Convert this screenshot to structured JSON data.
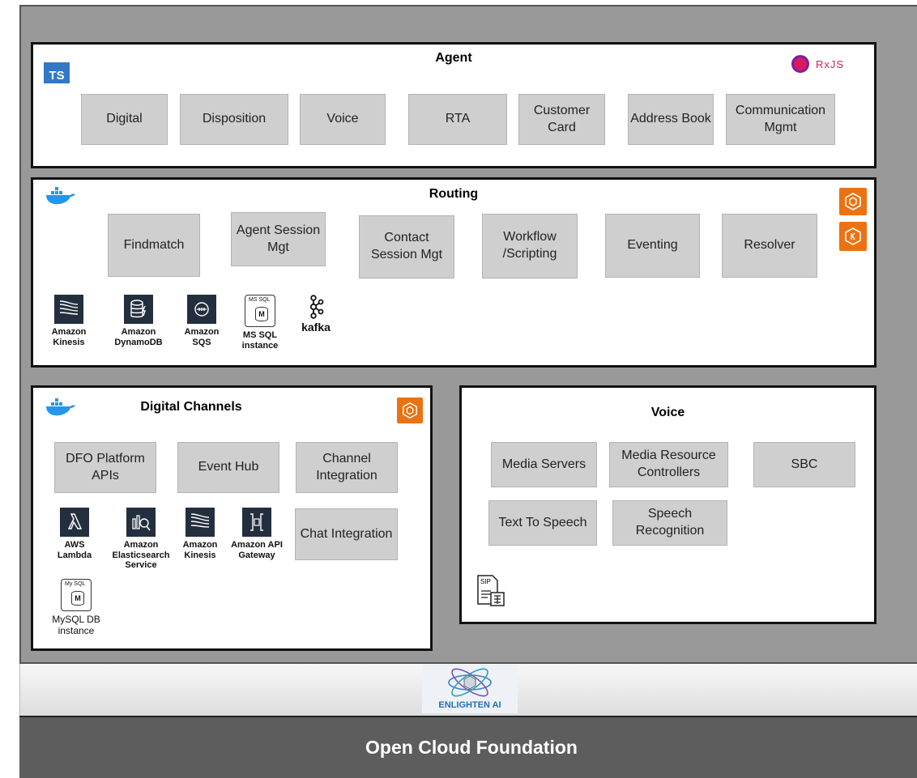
{
  "agent": {
    "title": "Agent",
    "ts_badge": "TS",
    "rxjs_label": "RxJS",
    "boxes": [
      "Digital",
      "Disposition",
      "Voice",
      "RTA",
      "Customer Card",
      "Address Book",
      "Communication Mgmt"
    ]
  },
  "routing": {
    "title": "Routing",
    "boxes": [
      "Findmatch",
      "Agent Session Mgt",
      "Contact Session Mgt",
      "Workflow /Scripting",
      "Eventing",
      "Resolver"
    ],
    "services": [
      "Amazon Kinesis",
      "Amazon DynamoDB",
      "Amazon SQS",
      "MS SQL instance"
    ],
    "mssql_icon_label": "MS SQL",
    "kafka_label": "kafka"
  },
  "digital_channels": {
    "title": "Digital Channels",
    "boxes": [
      "DFO Platform APIs",
      "Event Hub",
      "Channel Integration",
      "Chat Integration"
    ],
    "services": [
      "AWS Lambda",
      "Amazon Elasticsearch Service",
      "Amazon Kinesis",
      "Amazon API Gateway",
      "MySQL DB instance"
    ],
    "mysql_icon_label": "My SQL"
  },
  "voice": {
    "title": "Voice",
    "boxes": [
      "Media Servers",
      "Media Resource Controllers",
      "SBC",
      "Text To Speech",
      "Speech Recognition"
    ],
    "sip_label": "SIP"
  },
  "enlighten": {
    "label": "ENLIGHTEN AI"
  },
  "foundation": {
    "label": "Open Cloud Foundation"
  },
  "colors": {
    "aws_dark": "#232f3e",
    "aws_orange": "#ec7211",
    "docker_blue": "#2496ed",
    "rxjs_pink": "#d81b60",
    "ts_blue": "#3178c6"
  }
}
